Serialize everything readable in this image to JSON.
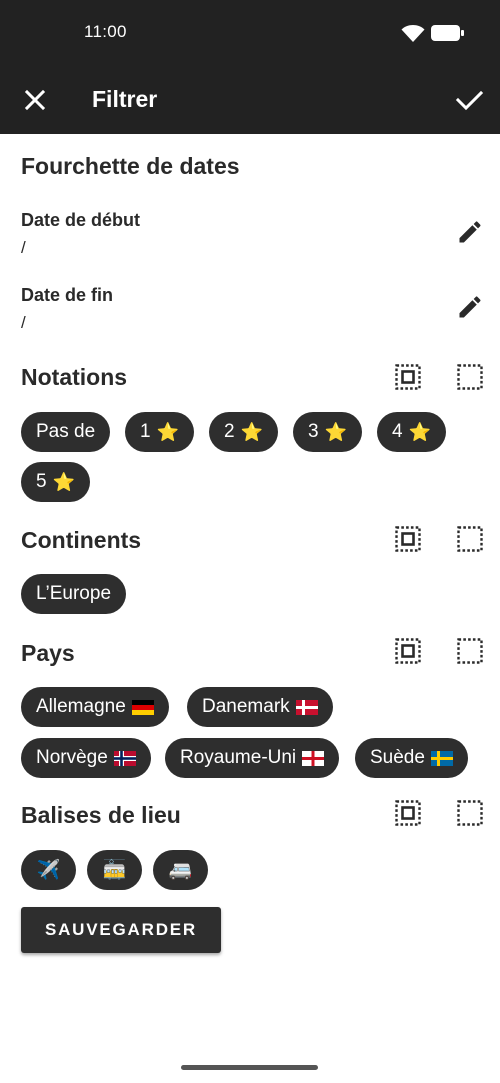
{
  "status_bar": {
    "time": "11:00"
  },
  "app_bar": {
    "title": "Filtrer",
    "close_icon": "close-icon",
    "confirm_icon": "check-icon"
  },
  "date_range": {
    "title": "Fourchette de dates",
    "start": {
      "label": "Date de début",
      "value": "/"
    },
    "end": {
      "label": "Date de fin",
      "value": "/"
    }
  },
  "ratings": {
    "title": "Notations",
    "chips": [
      {
        "label": "Pas de",
        "emoji": ""
      },
      {
        "label": "1",
        "emoji": "⭐"
      },
      {
        "label": "2",
        "emoji": "⭐"
      },
      {
        "label": "3",
        "emoji": "⭐"
      },
      {
        "label": "4",
        "emoji": "⭐"
      },
      {
        "label": "5",
        "emoji": "⭐"
      }
    ]
  },
  "continents": {
    "title": "Continents",
    "chips": [
      {
        "label": "L’Europe"
      }
    ]
  },
  "countries": {
    "title": "Pays",
    "chips": [
      {
        "label": "Allemagne",
        "flag": "germany"
      },
      {
        "label": "Danemark",
        "flag": "denmark"
      },
      {
        "label": "Norvège",
        "flag": "norway"
      },
      {
        "label": "Royaume-Uni",
        "flag": "england"
      },
      {
        "label": "Suède",
        "flag": "sweden"
      }
    ]
  },
  "place_tags": {
    "title": "Balises de lieu",
    "chips": [
      {
        "emoji": "✈️",
        "icon": "airplane-icon"
      },
      {
        "emoji": "🚋",
        "icon": "tram-icon"
      },
      {
        "emoji": "🚐",
        "icon": "minibus-icon"
      }
    ]
  },
  "save_button": {
    "label": "SAUVEGARDER"
  }
}
